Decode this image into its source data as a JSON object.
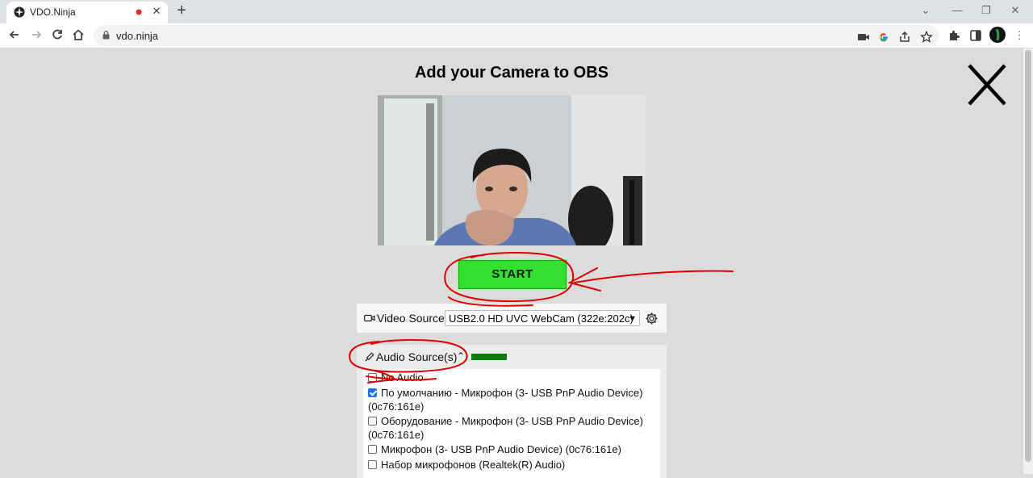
{
  "browser": {
    "tab_title": "VDO.Ninja",
    "tab_close": "✕",
    "new_tab": "+",
    "url": "vdo.ninja",
    "window_controls": [
      "⌄",
      "—",
      "❐",
      "✕"
    ],
    "toolbar_icons": [
      "camera-icon",
      "google-icon",
      "share-icon",
      "star-icon",
      "extensions-icon",
      "sidepanel-icon",
      "profile-avatar",
      "menu-icon"
    ]
  },
  "page": {
    "title": "Add your Camera to OBS",
    "start_button": "START",
    "video_source": {
      "label": "Video Source",
      "selected": "USB2.0 HD UVC WebCam (322e:202c)"
    },
    "audio_source": {
      "label": "Audio Source(s)",
      "expanded": true,
      "items": [
        {
          "label": "No Audio",
          "checked": false
        },
        {
          "label": "По умолчанию - Микрофон (3- USB PnP Audio Device)",
          "line2": "(0c76:161e)",
          "checked": true
        },
        {
          "label": "Оборудование - Микрофон (3- USB PnP Audio Device)",
          "line2": "(0c76:161e)",
          "checked": false
        },
        {
          "label": "Микрофон (3- USB PnP Audio Device) (0c76:161e)",
          "checked": false
        },
        {
          "label": "Набор микрофонов (Realtek(R) Audio)",
          "checked": false
        }
      ]
    }
  },
  "colors": {
    "start_button": "#33e02f",
    "audio_meter": "#0a7d0a",
    "annotation": "#e00000",
    "page_background": "#dcdcdc"
  }
}
